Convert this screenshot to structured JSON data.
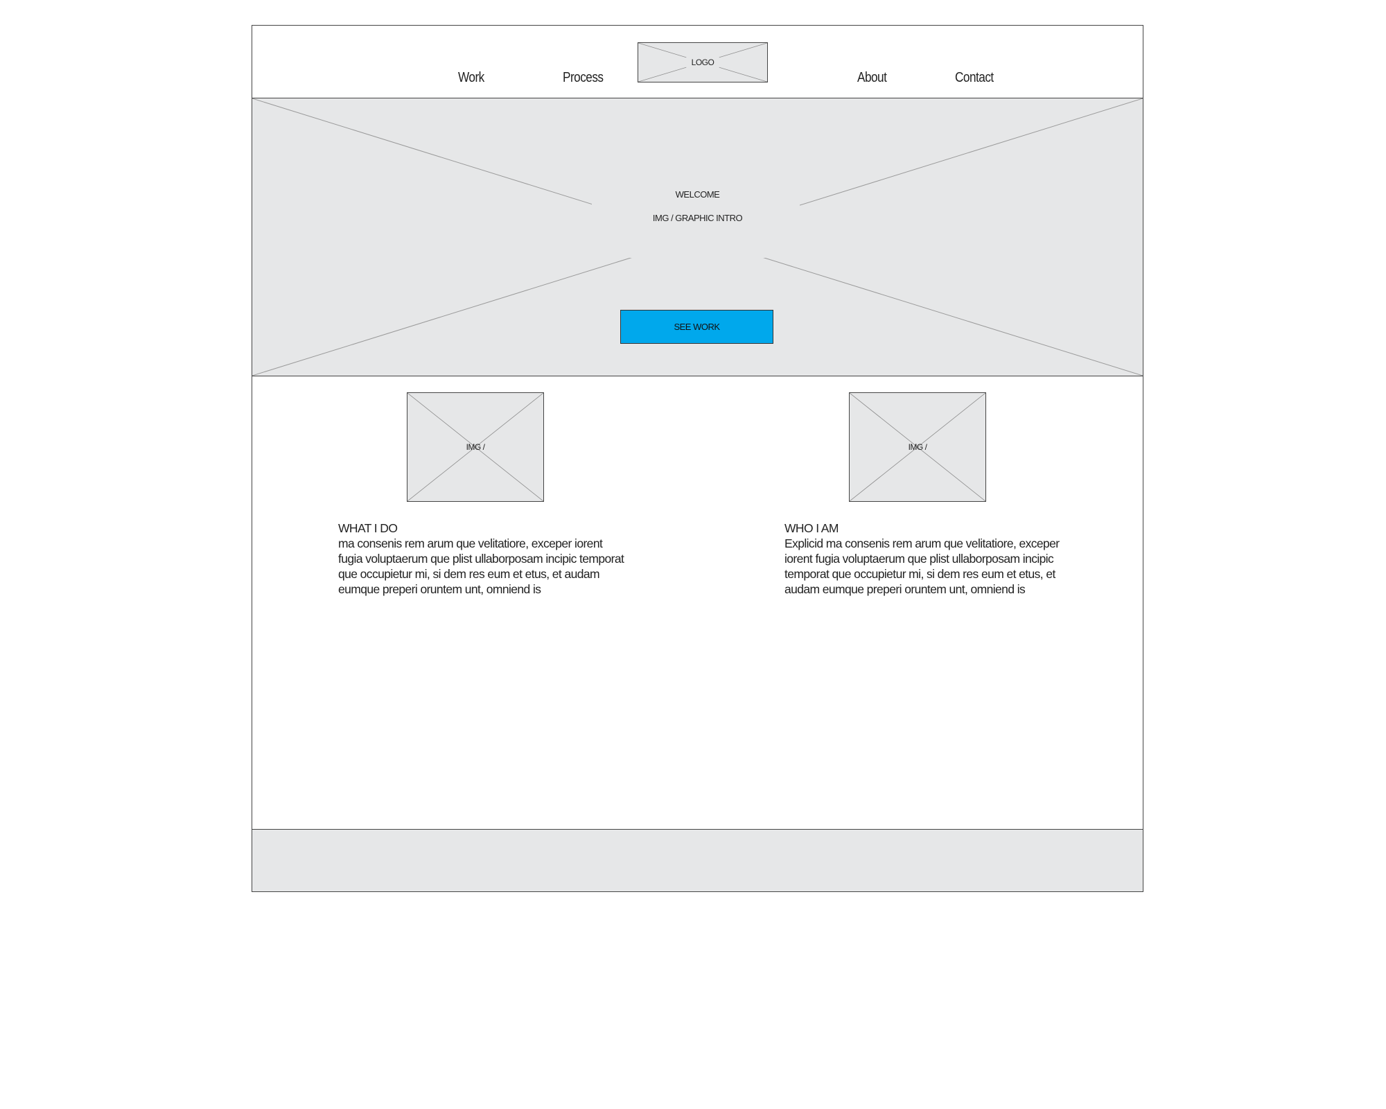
{
  "nav": {
    "items": [
      {
        "label": "Work"
      },
      {
        "label": "Process"
      },
      {
        "label": "About"
      },
      {
        "label": "Contact"
      }
    ],
    "logo_label": "LOGO"
  },
  "hero": {
    "welcome": "WELCOME",
    "intro": "IMG / GRAPHIC INTRO",
    "button_label": "SEE WORK"
  },
  "sections": [
    {
      "image_label": "IMG /",
      "heading": "WHAT I DO",
      "body": "ma consenis rem arum que velitatiore, exceper iorent fugia voluptaerum que plist ullaborposam incipic temporat que occupietur mi, si dem res eum et etus, et audam eumque preperi oruntem unt, omniend is"
    },
    {
      "image_label": "IMG /",
      "heading": "WHO I AM",
      "body": "Explicid ma consenis rem arum que velitatiore, exceper iorent fugia voluptaerum que plist ullaborposam incipic temporat que occupietur mi, si dem res eum et etus, et audam eumque preperi oruntem unt, omniend is"
    }
  ],
  "colors": {
    "placeholder_fill": "#e6e7e8",
    "button_accent": "#00a8ec",
    "border": "#444444"
  }
}
